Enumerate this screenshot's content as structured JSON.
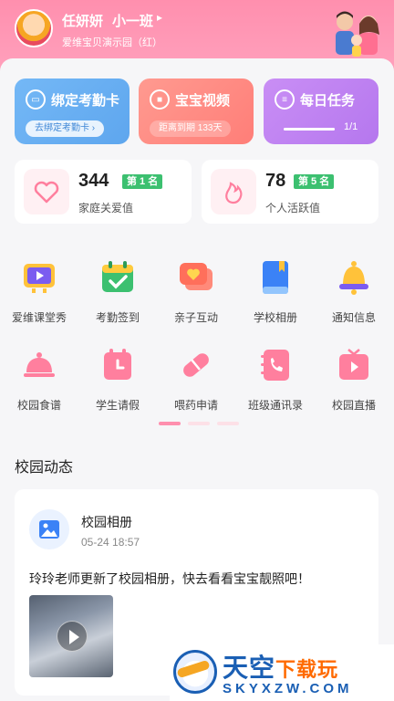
{
  "header": {
    "user_name": "任妍妍",
    "class_name": "小一班",
    "class_arrow": "▸",
    "school_name": "爱维宝贝演示园（红）"
  },
  "cards": {
    "bind": {
      "title": "绑定考勤卡",
      "action": "去绑定考勤卡 ›",
      "icon": "card-scan-icon"
    },
    "video": {
      "title": "宝宝视频",
      "expiry": "距离到期 133天",
      "icon": "video-camera-icon"
    },
    "task": {
      "title": "每日任务",
      "progress_text": "1/1",
      "progress": 1.0,
      "icon": "task-list-icon"
    }
  },
  "stats": {
    "love": {
      "value": "344",
      "rank": "第 1 名",
      "label": "家庭关爱值",
      "icon": "heart-icon"
    },
    "active": {
      "value": "78",
      "rank": "第 5 名",
      "label": "个人活跃值",
      "icon": "flame-icon"
    }
  },
  "grid": [
    {
      "label": "爱维课堂秀",
      "icon": "tv-play-icon"
    },
    {
      "label": "考勤签到",
      "icon": "calendar-check-icon"
    },
    {
      "label": "亲子互动",
      "icon": "chat-heart-icon"
    },
    {
      "label": "学校相册",
      "icon": "album-book-icon"
    },
    {
      "label": "通知信息",
      "icon": "bell-icon"
    },
    {
      "label": "校园食谱",
      "icon": "food-cloche-icon"
    },
    {
      "label": "学生请假",
      "icon": "leave-calendar-icon"
    },
    {
      "label": "喂药申请",
      "icon": "pill-icon"
    },
    {
      "label": "班级通讯录",
      "icon": "phone-book-icon"
    },
    {
      "label": "校园直播",
      "icon": "live-tv-icon"
    }
  ],
  "section": {
    "title": "校园动态"
  },
  "news": {
    "title": "校园相册",
    "time": "05-24 18:57",
    "text": "玲玲老师更新了校园相册，快去看看宝宝靓照吧！",
    "icon": "photo-icon"
  },
  "watermark": {
    "title_main": "天空",
    "title_accent": "下载玩",
    "subtitle": "SKYXZW.COM"
  },
  "colors": {
    "header_pink": "#ff8fae",
    "blue_card": "#5ea6ee",
    "coral_card": "#ff7e78",
    "purple_card": "#b577ee",
    "rank_green": "#3cc070"
  }
}
